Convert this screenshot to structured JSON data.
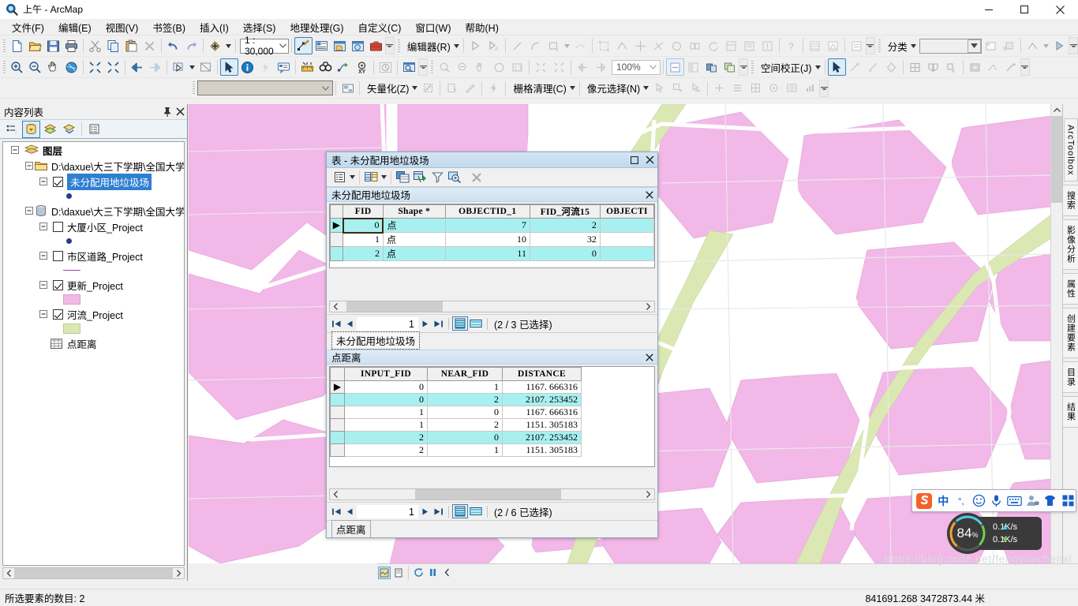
{
  "window": {
    "title": "上午 - ArcMap",
    "icon": "arcmap-magnifier-icon",
    "minimize": "─",
    "maximize": "☐",
    "close": "✕"
  },
  "menubar": {
    "items": [
      {
        "label": "文件(F)",
        "name": "menu-file"
      },
      {
        "label": "编辑(E)",
        "name": "menu-edit"
      },
      {
        "label": "视图(V)",
        "name": "menu-view"
      },
      {
        "label": "书签(B)",
        "name": "menu-bookmarks"
      },
      {
        "label": "插入(I)",
        "name": "menu-insert"
      },
      {
        "label": "选择(S)",
        "name": "menu-selection"
      },
      {
        "label": "地理处理(G)",
        "name": "menu-geoprocessing"
      },
      {
        "label": "自定义(C)",
        "name": "menu-customize"
      },
      {
        "label": "窗口(W)",
        "name": "menu-window"
      },
      {
        "label": "帮助(H)",
        "name": "menu-help"
      }
    ]
  },
  "toolbars": {
    "standard": {
      "scale_value": "1 : 30,000",
      "buttons": [
        "new-document",
        "open-document",
        "save",
        "print",
        "cut",
        "copy",
        "paste",
        "delete",
        "undo",
        "redo",
        "add-data"
      ]
    },
    "editor": {
      "label": "编辑器(R)",
      "buttons": [
        "edit-tool",
        "edit-annotation",
        "straight-segment",
        "arc-segment",
        "rectangle",
        "trace",
        "edit-vertices",
        "reshape",
        "split",
        "construct"
      ]
    },
    "classify": {
      "label": "分类",
      "value": "",
      "placeholder": ""
    },
    "tools": {
      "zoom_value": "100%",
      "buttons": [
        "zoom-in",
        "zoom-out",
        "pan",
        "full-extent",
        "fixed-zoom-in",
        "fixed-zoom-out",
        "back-extent",
        "forward-extent",
        "select-features",
        "select-elements",
        "identify",
        "hyperlink",
        "html-popup",
        "measure",
        "find",
        "find-route",
        "go-to-xy",
        "time-slider",
        "create-viewer"
      ]
    },
    "spatial_adjustment": {
      "label": "空间校正(J)"
    },
    "arcscan": {
      "vectorization_label": "矢量化(Z)",
      "raster_cleanup_label": "栅格清理(C)",
      "cell_selection_label": "像元选择(N)"
    }
  },
  "toc": {
    "title": "内容列表",
    "pin_icon": "pin-icon",
    "close_icon": "close-icon",
    "tool_buttons": [
      "list-by-drawing-order",
      "list-by-source",
      "list-by-visibility",
      "list-by-selection",
      "options"
    ],
    "tree": [
      {
        "level": 0,
        "label": "图层",
        "type": "root",
        "icon": "layers-icon",
        "bold": true,
        "selected": false
      },
      {
        "level": 1,
        "label": "D:\\daxue\\大三下学期\\全国大学",
        "type": "folder",
        "icon": "folder-icon",
        "checkbox": null
      },
      {
        "level": 2,
        "label": "未分配用地垃圾场",
        "type": "layer",
        "checkbox": true,
        "selected": true,
        "symbol": "point",
        "symbol_color": "#283a8c"
      },
      {
        "level": 1,
        "label": "D:\\daxue\\大三下学期\\全国大学",
        "type": "database",
        "icon": "database-icon",
        "checkbox": null
      },
      {
        "level": 2,
        "label": "大厦小区_Project",
        "type": "layer",
        "checkbox": false,
        "symbol": "point",
        "symbol_color": "#283a8c"
      },
      {
        "level": 2,
        "label": "市区道路_Project",
        "type": "layer",
        "checkbox": false,
        "symbol": "line",
        "symbol_color": "#a43fb0"
      },
      {
        "level": 2,
        "label": "更新_Project",
        "type": "layer",
        "checkbox": true,
        "symbol": "polygon",
        "symbol_color": "#f2b8e8"
      },
      {
        "level": 2,
        "label": "河流_Project",
        "type": "layer",
        "checkbox": true,
        "symbol": "polygon",
        "symbol_color": "#dbe8b4"
      },
      {
        "level": 2,
        "label": "点距离",
        "type": "table",
        "icon": "table-icon",
        "checkbox": null
      }
    ]
  },
  "right_dock": {
    "tabs": [
      "ArcToolbox",
      "搜索",
      "影像分析",
      "属性",
      "创建要素",
      "目录",
      "结果"
    ]
  },
  "table_window": {
    "title": "表 - 未分配用地垃圾场",
    "maximize_icon": "maximize-icon",
    "close_icon": "close-icon",
    "toolbar_buttons": [
      "table-options",
      "related-tables",
      "move-field",
      "join-relate",
      "select-by-attributes",
      "zoom-to-selected",
      "clear-selection"
    ],
    "panels": [
      {
        "name": "未分配用地垃圾场",
        "columns": [
          "",
          "FID",
          "Shape *",
          "OBJECTID_1",
          "FID_河流15",
          "OBJECTI"
        ],
        "rows": [
          {
            "marker": "▶",
            "cells": [
              "0",
              "点",
              "7",
              "2",
              ""
            ],
            "selected": true,
            "current": true
          },
          {
            "marker": "",
            "cells": [
              "1",
              "点",
              "10",
              "32",
              ""
            ],
            "selected": false,
            "current": false
          },
          {
            "marker": "",
            "cells": [
              "2",
              "点",
              "11",
              "0",
              ""
            ],
            "selected": true,
            "current": false
          }
        ],
        "nav": {
          "first": "⏮",
          "prev": "◀",
          "record": "1",
          "next": "▶",
          "last": "⏭",
          "status": "(2 / 3 已选择)"
        },
        "tab_label": "未分配用地垃圾场"
      },
      {
        "name": "点距离",
        "columns": [
          "",
          "INPUT_FID",
          "NEAR_FID",
          "DISTANCE"
        ],
        "rows": [
          {
            "marker": "▶",
            "cells": [
              "0",
              "1",
              "1167. 666316"
            ],
            "selected": false
          },
          {
            "marker": "",
            "cells": [
              "0",
              "2",
              "2107. 253452"
            ],
            "selected": true
          },
          {
            "marker": "",
            "cells": [
              "1",
              "0",
              "1167. 666316"
            ],
            "selected": false
          },
          {
            "marker": "",
            "cells": [
              "1",
              "2",
              "1151. 305183"
            ],
            "selected": false
          },
          {
            "marker": "",
            "cells": [
              "2",
              "0",
              "2107. 253452"
            ],
            "selected": true
          },
          {
            "marker": "",
            "cells": [
              "2",
              "1",
              "1151. 305183"
            ],
            "selected": false
          }
        ],
        "nav": {
          "first": "⏮",
          "prev": "◀",
          "record": "1",
          "next": "▶",
          "last": "⏭",
          "status": "(2 / 6 已选择)"
        },
        "tab_label": "点距离"
      }
    ]
  },
  "statusbar": {
    "left_text": "所选要素的数目: 2",
    "coordinates": "841691.268  3472873.44 米"
  },
  "floating": {
    "ime": {
      "logo": "sogou-logo-icon",
      "items": [
        "中",
        "°,",
        "smiley-icon",
        "microphone-icon",
        "keyboard-icon",
        "user-icon",
        "skin-icon",
        "apps-icon"
      ]
    },
    "network": {
      "percent": "84",
      "percent_unit": "%",
      "upload": "0.1K/s",
      "download": "0.1K/s"
    }
  },
  "watermark": "https://blog.csdn.net/fengyuechenxi",
  "colors": {
    "selection_cyan": "#a8f0f0",
    "toc_selection_blue": "#2f7fd1",
    "map_polygon_pink": "#f2b8e8",
    "map_river_green": "#dbe8b4",
    "title_bar_blue": "#c2d9ec"
  }
}
